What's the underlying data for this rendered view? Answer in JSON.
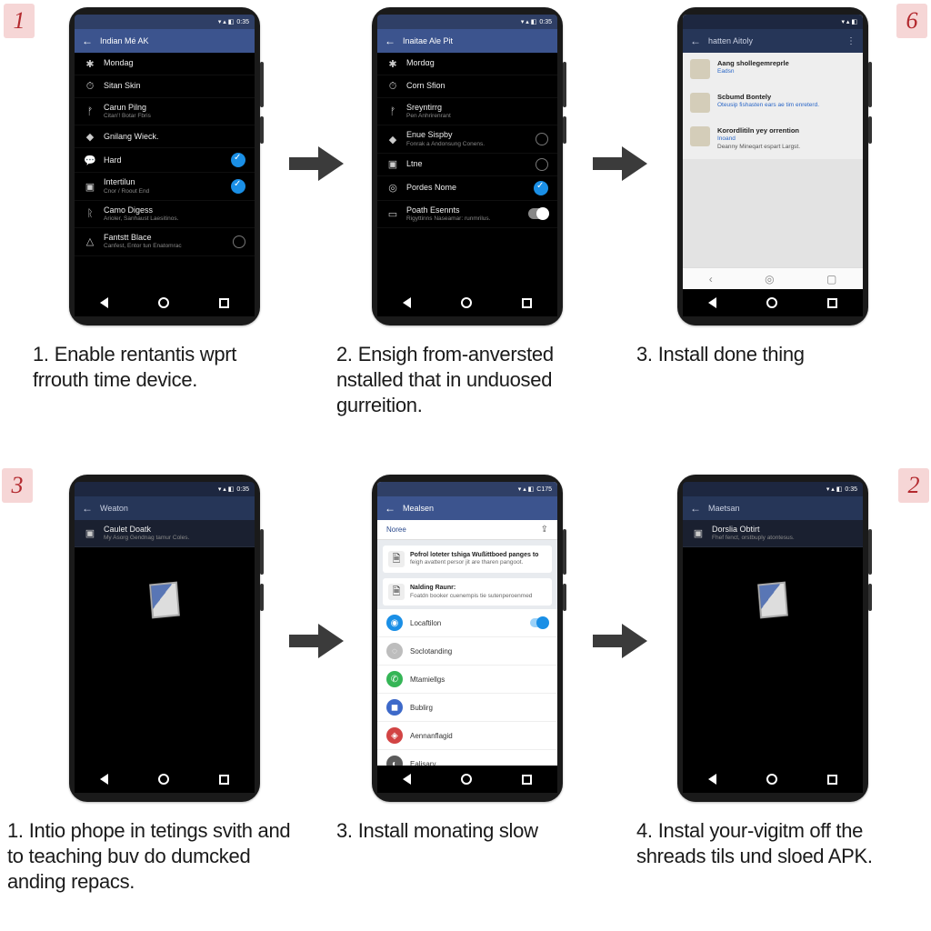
{
  "badges": {
    "top_left": "1",
    "top_right": "6",
    "bottom_left": "3",
    "bottom_right": "2"
  },
  "statusbar_time": "0:35",
  "captions": {
    "r1c1": {
      "num": "1.",
      "text": "Enable rentantis wprt frrouth time device."
    },
    "r1c2": {
      "num": "2.",
      "text": "Ensigh from-anversted nstalled that in unduosed gurreition."
    },
    "r1c3": {
      "num": "3.",
      "text": "Install done thing"
    },
    "r2c1": {
      "num": "1.",
      "text": "Intio phope in tetings svith and to teaching buv do dumcked anding repacs."
    },
    "r2c2": {
      "num": "3.",
      "text": "Install monating slow"
    },
    "r2c3": {
      "num": "4.",
      "text": "Instal your-vigitm off the shreads tils und sloed APK."
    }
  },
  "phone1": {
    "title": "Indian Mé AK",
    "rows": [
      {
        "icon": "✱",
        "title": "Mondag",
        "sub": ""
      },
      {
        "icon": "⏱",
        "title": "Sitan Skin",
        "sub": ""
      },
      {
        "icon": "ᚠ",
        "title": "Carun Pilng",
        "sub": "Citan'! Botar Fbris"
      },
      {
        "icon": "◆",
        "title": "Gnilang Wieck.",
        "sub": ""
      },
      {
        "icon": "💬",
        "title": "Hard",
        "sub": "",
        "kind": "check",
        "on": true
      },
      {
        "icon": "▣",
        "title": "Intertilun",
        "sub": "Cnor / Roout End",
        "kind": "check",
        "on": true
      },
      {
        "icon": "ᚱ",
        "title": "Camo Digess",
        "sub": "Arioler, Sanhaust Laesitinos."
      },
      {
        "icon": "△",
        "title": "Fantstt Blace",
        "sub": "Canfest, Entor tun Enatomrac",
        "kind": "radio"
      }
    ]
  },
  "phone2": {
    "title": "Inaitae Ale Pit",
    "rows": [
      {
        "icon": "✱",
        "title": "Mordαg",
        "sub": ""
      },
      {
        "icon": "⏱",
        "title": "Corn Sfion",
        "sub": ""
      },
      {
        "icon": "ᚠ",
        "title": "Sreyntirrg",
        "sub": "Pen Anhrirenrant"
      },
      {
        "icon": "◆",
        "title": "Enue Sispby",
        "sub": "Fonrak a Andonsung Conens.",
        "kind": "radio"
      },
      {
        "icon": "▣",
        "title": "Ltne",
        "sub": "",
        "kind": "radio"
      },
      {
        "icon": "◎",
        "title": "Pordes Nome",
        "sub": "",
        "kind": "check",
        "on": true
      },
      {
        "icon": "▭",
        "title": "Poath Esennts",
        "sub": "Rigyttinns Naseamar: runmrilus.",
        "kind": "toggle"
      }
    ]
  },
  "phone3": {
    "title": "hatten Aitoly",
    "items": [
      {
        "title": "Aang shollegemreprle",
        "sub": "Eadsn"
      },
      {
        "title": "Scbumd Bontely",
        "sub": "Oteusip fishasten ears ae tim enreterd."
      },
      {
        "title": "Korordlitiln yey orrention",
        "sub": "Inoand",
        "more": "Deanny Mineqart espart Largst."
      }
    ]
  },
  "phone4": {
    "title": "Weaton",
    "row": {
      "title": "Caulet Doatk",
      "sub": "My Asorg Gendnag tamur Coles."
    }
  },
  "phone5": {
    "title": "Mealsen",
    "tab": "Noree",
    "cards": [
      {
        "title": "Pofrol loteter tshiga Wußittboed panges to",
        "sub": "feigh avattent persor jit are tharen pangoot."
      },
      {
        "title": "Nalding Raunr:",
        "sub": "Foatdn booker cuenempis tie sutenperoenmed"
      }
    ],
    "rows": [
      {
        "color": "#1a8fe6",
        "icon": "◉",
        "label": "Locaftilon",
        "toggle": true
      },
      {
        "color": "#bdbdbd",
        "icon": "◌",
        "label": "Soclotanding"
      },
      {
        "color": "#35b556",
        "icon": "✆",
        "label": "Mtamiellgs"
      },
      {
        "color": "#3d69c9",
        "icon": "◼",
        "label": "Bublirg"
      },
      {
        "color": "#d24444",
        "icon": "◈",
        "label": "Aennanflagid"
      },
      {
        "color": "#5a5a5a",
        "icon": "◐",
        "label": "Ealisary"
      }
    ]
  },
  "phone6": {
    "title": "Maetsan",
    "row": {
      "title": "Dorslia Obtirt",
      "sub": "Fhef fenct, orstbuply atontesus."
    }
  }
}
